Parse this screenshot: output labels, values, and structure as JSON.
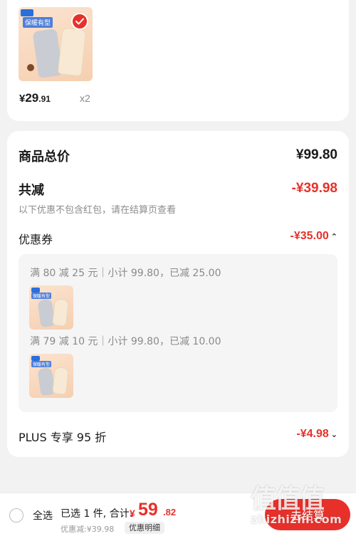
{
  "product": {
    "brand_mark": "Lovely",
    "tagline": "保暖有型",
    "price_symbol": "¥",
    "price_int": "29",
    "price_dec": ".91",
    "quantity": "x2",
    "selected": true
  },
  "summary": {
    "goods_total_label": "商品总价",
    "goods_total_value": "¥99.80",
    "total_discount_label": "共减",
    "total_discount_value": "-¥39.98",
    "discount_note": "以下优惠不包含红包，请在结算页查看",
    "coupon_label": "优惠券",
    "coupon_value": "-¥35.00",
    "coupons": [
      {
        "text": "满 80 减 25 元｜小计 99.80，已减 25.00"
      },
      {
        "text": "满 79 减 10 元｜小计 99.80，已减 10.00"
      }
    ],
    "plus_label": "PLUS 专享 95 折",
    "plus_value": "-¥4.98"
  },
  "bottom_bar": {
    "select_all": "全选",
    "selected_info": "已选 1 件, 合计:",
    "total_symbol": "¥",
    "total_int": "59",
    "total_dec": ".82",
    "saved": "优惠减:¥39.98",
    "detail": "优惠明细",
    "checkout": "去结算"
  },
  "watermark": {
    "glyphs": "值值值",
    "url": "zhizhizhi.com"
  },
  "colors": {
    "accent_red": "#e8302a",
    "background": "#f2f2f2"
  }
}
